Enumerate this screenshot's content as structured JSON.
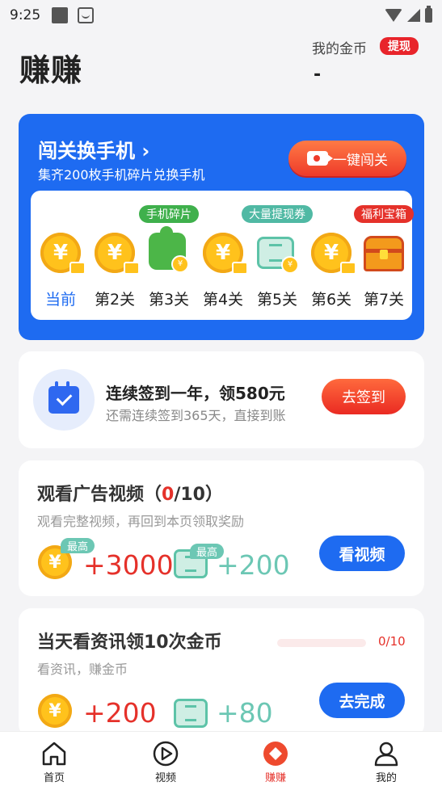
{
  "status_bar": {
    "time": "9:25"
  },
  "header": {
    "title": "赚赚",
    "coin_label": "我的金币",
    "withdraw_label": "提现",
    "coin_value": "-"
  },
  "challenge": {
    "title": "闯关换手机 ›",
    "subtitle": "集齐200枚手机碎片兑换手机",
    "button_label": "一键闯关",
    "levels": [
      {
        "label": "当前",
        "icon": "coin-video-icon",
        "tag": ""
      },
      {
        "label": "第2关",
        "icon": "coin-video-icon",
        "tag": ""
      },
      {
        "label": "第3关",
        "icon": "puzzle-piece-icon",
        "tag": "手机碎片"
      },
      {
        "label": "第4关",
        "icon": "coin-video-icon",
        "tag": ""
      },
      {
        "label": "第5关",
        "icon": "ticket-icon",
        "tag": "大量提现券"
      },
      {
        "label": "第6关",
        "icon": "coin-video-icon",
        "tag": ""
      },
      {
        "label": "第7关",
        "icon": "treasure-chest-icon",
        "tag": "福利宝箱"
      }
    ]
  },
  "signin": {
    "title": "连续签到一年，领580元",
    "subtitle": "还需连续签到365天，直接到账",
    "button_label": "去签到"
  },
  "task_video": {
    "title_prefix": "观看广告视频（",
    "done": "0",
    "title_suffix": "/10）",
    "desc": "观看完整视频，再回到本页领取奖励",
    "max_tag": "最高",
    "coin_reward": "+3000",
    "ticket_reward": "+200",
    "button_label": "看视频"
  },
  "task_news": {
    "title": "当天看资讯领10次金币",
    "desc": "看资讯，赚金币",
    "progress_text": "0/10",
    "progress_fraction": 0,
    "coin_reward": "+200",
    "ticket_reward": "+80",
    "button_label": "去完成"
  },
  "tabbar": [
    {
      "label": "首页",
      "icon": "home-icon"
    },
    {
      "label": "视频",
      "icon": "play-icon"
    },
    {
      "label": "赚赚",
      "icon": "earn-diamond-icon"
    },
    {
      "label": "我的",
      "icon": "profile-icon"
    }
  ],
  "colors": {
    "brand_blue": "#1e6bf1",
    "accent_red": "#e5312a",
    "coin_gold": "#ffc21c",
    "ticket_teal": "#5dc3a8"
  }
}
